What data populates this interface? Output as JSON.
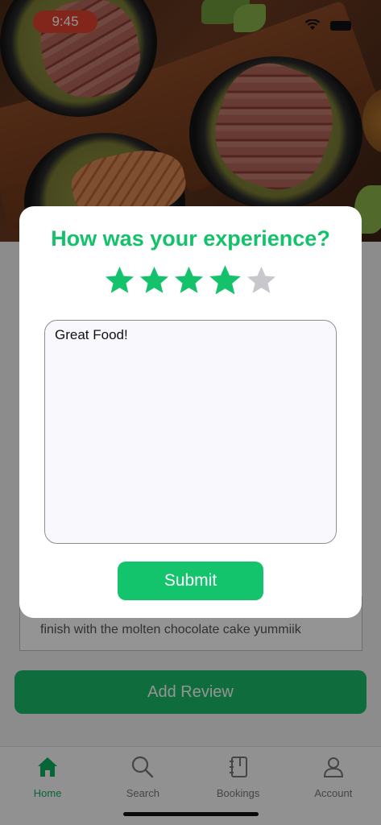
{
  "status_bar": {
    "time": "9:45"
  },
  "review_modal": {
    "title": "How was your experience?",
    "rating": 4,
    "max_rating": 5,
    "review_text": "Great Food!",
    "submit_label": "Submit"
  },
  "background_page": {
    "review_snippet": "finish with the molten chocolate cake yummiik",
    "add_review_label": "Add Review"
  },
  "tab_bar": {
    "items": [
      {
        "label": "Home",
        "icon": "home-icon",
        "active": true
      },
      {
        "label": "Search",
        "icon": "search-icon",
        "active": false
      },
      {
        "label": "Bookings",
        "icon": "bookings-icon",
        "active": false
      },
      {
        "label": "Account",
        "icon": "account-icon",
        "active": false
      }
    ]
  },
  "colors": {
    "accent": "#14c26b",
    "star_filled": "#14c26b",
    "star_empty": "#c7c7cc",
    "status_pill": "#e0432f"
  }
}
